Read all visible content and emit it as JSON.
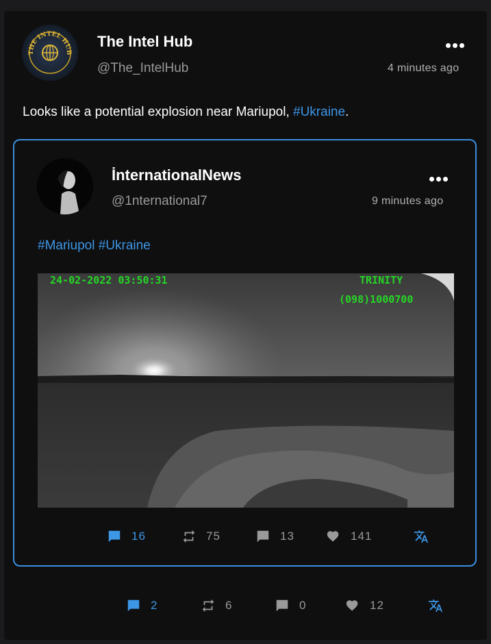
{
  "post": {
    "author_name": "The Intel Hub",
    "handle": "@The_IntelHub",
    "time": "4 minutes ago",
    "avatar_text": "THE INTEL HUB",
    "text_before": "Looks like a potential explosion near Mariupol, ",
    "hashtag": "#Ukraine",
    "text_after": ".",
    "stats": {
      "replies": "2",
      "reposts": "6",
      "comments": "0",
      "likes": "12"
    }
  },
  "quoted": {
    "author_name": "İnternationalNews",
    "handle": "@1nternational7",
    "time": "9 minutes ago",
    "hashtags": [
      "#Mariupol",
      "#Ukraine"
    ],
    "media": {
      "timestamp": "24-02-2022 03:50:31",
      "camera_label": "TRINITY",
      "phone": "(098)1000700"
    },
    "stats": {
      "replies": "16",
      "reposts": "75",
      "comments": "13",
      "likes": "141"
    }
  },
  "icons": {
    "reply": "reply-bubble-icon",
    "repost": "repost-icon",
    "comment": "comment-icon",
    "like": "heart-icon",
    "translate": "translate-icon",
    "more": "more-dots-icon"
  },
  "colors": {
    "accent": "#3d96e6",
    "background": "#0f0f10",
    "muted": "#9a9a9a"
  }
}
